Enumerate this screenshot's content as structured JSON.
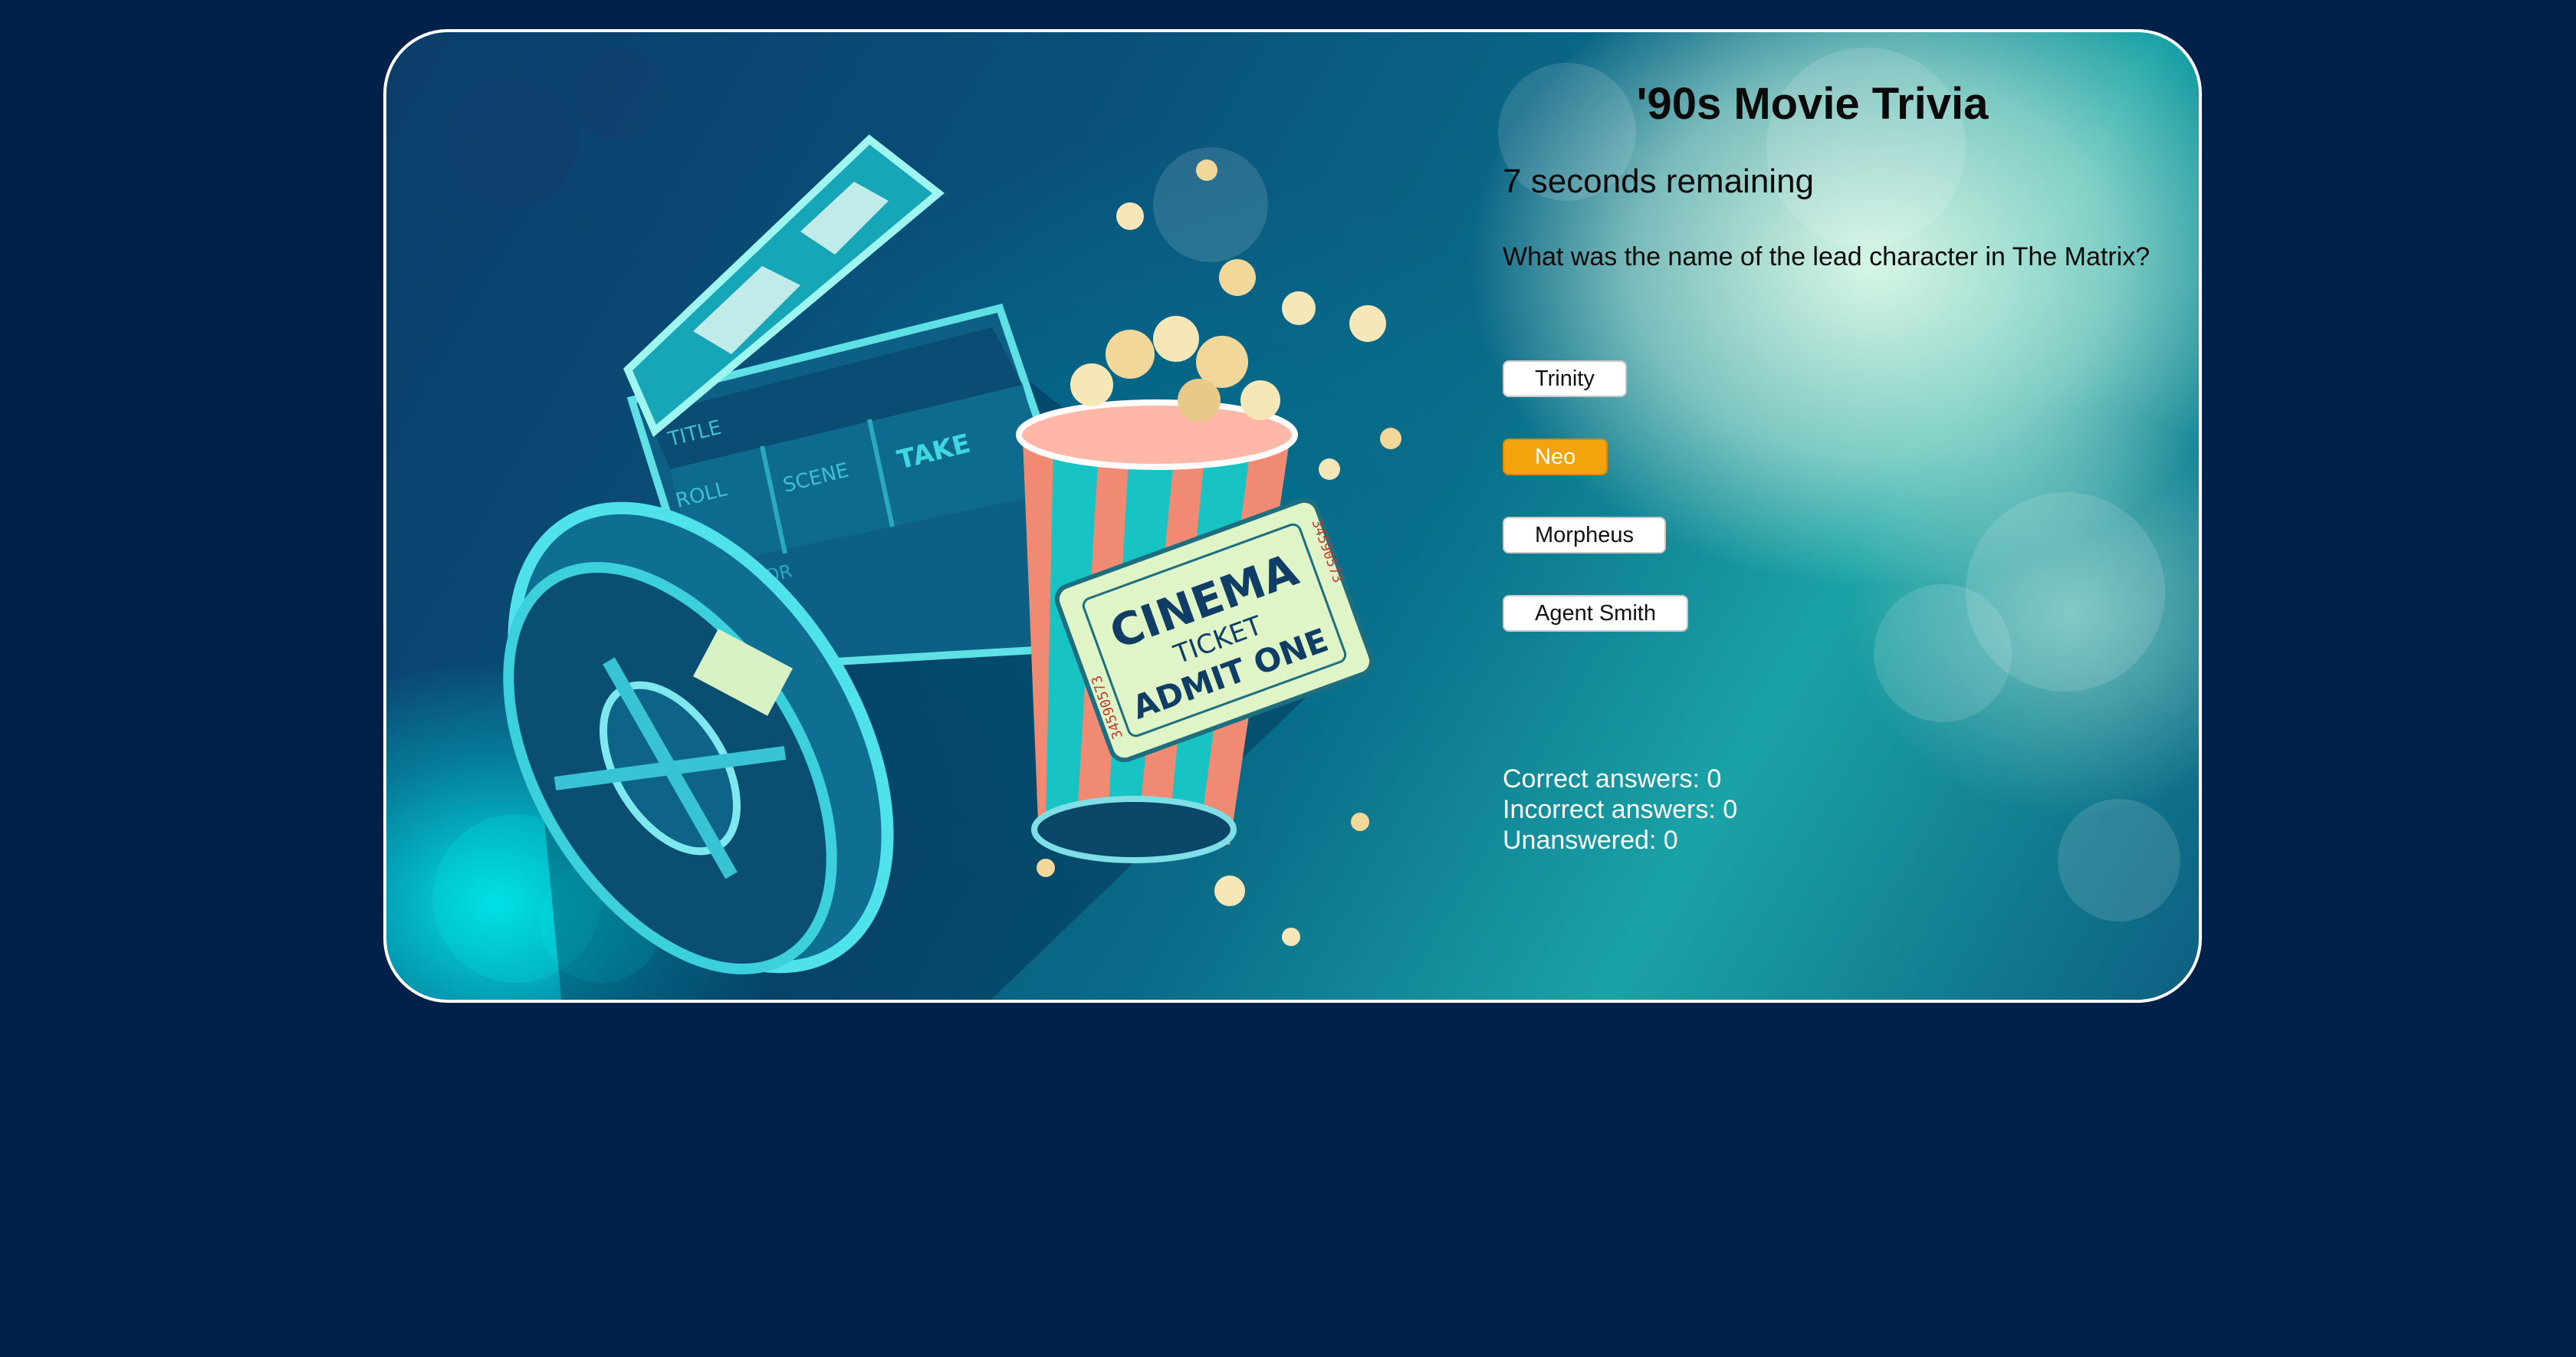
{
  "game": {
    "title": "'90s Movie Trivia",
    "timer_text": "7 seconds remaining",
    "question": "What was the name of the lead character in The Matrix?",
    "answers": [
      {
        "label": "Trinity",
        "selected": false
      },
      {
        "label": "Neo",
        "selected": true
      },
      {
        "label": "Morpheus",
        "selected": false
      },
      {
        "label": "Agent Smith",
        "selected": false
      }
    ],
    "score": {
      "correct": "Correct answers: 0",
      "incorrect": "Incorrect answers: 0",
      "unanswered": "Unanswered: 0"
    }
  },
  "illustration": {
    "clapper_labels": [
      "TITLE",
      "ROLL",
      "SCENE",
      "TAKE",
      "DIRECTOR"
    ],
    "ticket": {
      "line1": "CINEMA",
      "line2": "TICKET",
      "line3": "ADMIT ONE",
      "serial": "34590573"
    }
  },
  "colors": {
    "page_background": "#01214a",
    "card_border": "#ffffff",
    "selected_answer": "#f5a30c",
    "score_text": "#ffffff"
  }
}
